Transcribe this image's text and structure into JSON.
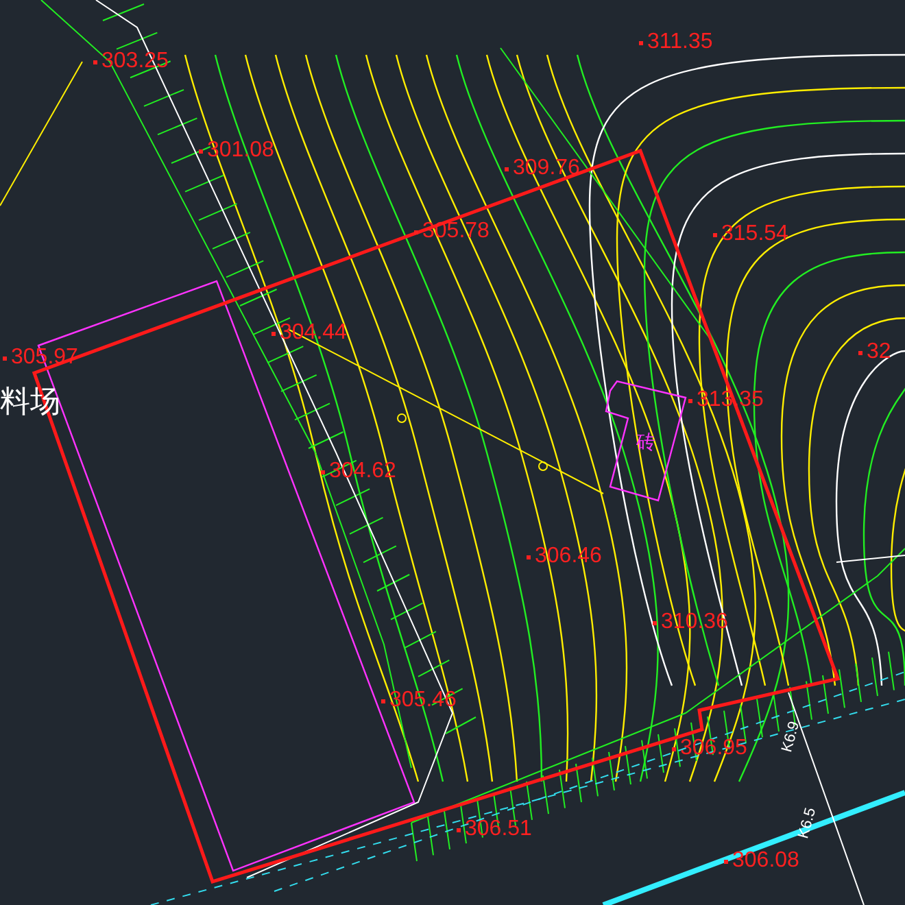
{
  "drawing": {
    "labels": [
      {
        "kind": "elevation",
        "text": "303.25"
      },
      {
        "kind": "elevation",
        "text": "301.08"
      },
      {
        "kind": "elevation",
        "text": "305.78"
      },
      {
        "kind": "elevation",
        "text": "309.76"
      },
      {
        "kind": "elevation",
        "text": "311.35"
      },
      {
        "kind": "elevation",
        "text": "315.54"
      },
      {
        "kind": "elevation",
        "text": "304.44"
      },
      {
        "kind": "elevation",
        "text": "305.97"
      },
      {
        "kind": "elevation",
        "text": "32"
      },
      {
        "kind": "elevation",
        "text": "313.35"
      },
      {
        "kind": "elevation",
        "text": "304.62"
      },
      {
        "kind": "elevation",
        "text": "306.46"
      },
      {
        "kind": "elevation",
        "text": "310.36"
      },
      {
        "kind": "elevation",
        "text": "305.46"
      },
      {
        "kind": "elevation",
        "text": "306.95"
      },
      {
        "kind": "elevation",
        "text": "306.51"
      },
      {
        "kind": "elevation",
        "text": "306.08"
      },
      {
        "kind": "area",
        "text": "料场"
      },
      {
        "kind": "building",
        "text": "砖"
      },
      {
        "kind": "station",
        "text": "K6.9"
      },
      {
        "kind": "station",
        "text": "K6.5"
      }
    ]
  }
}
